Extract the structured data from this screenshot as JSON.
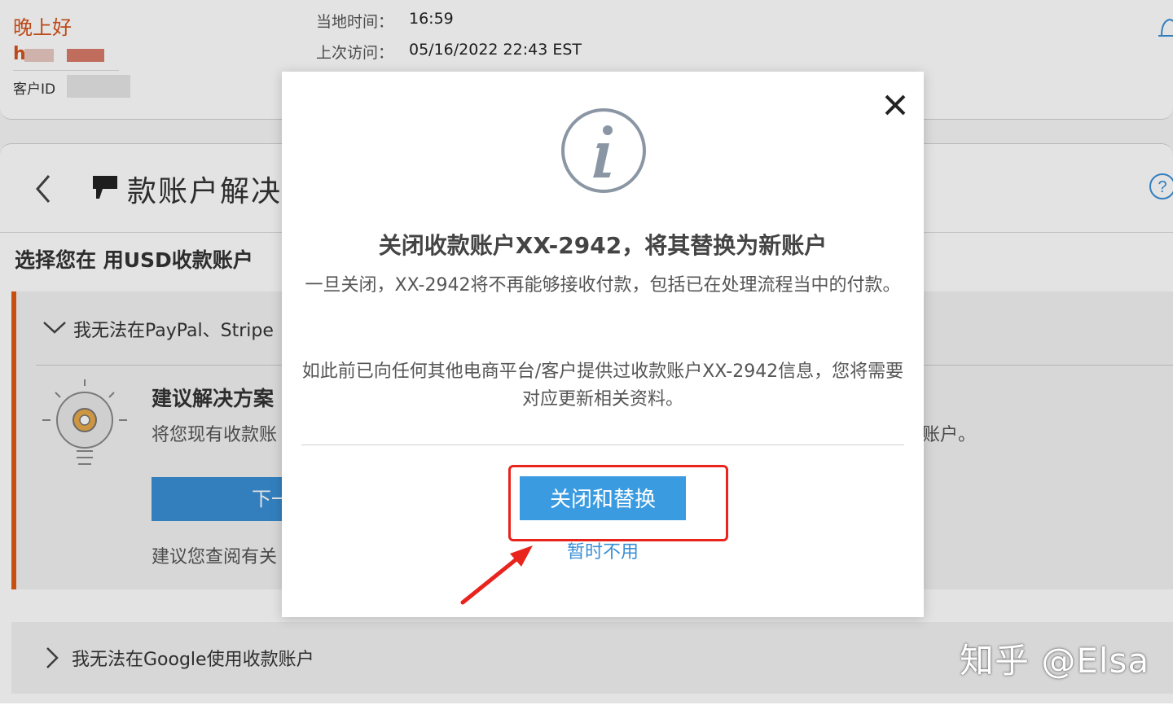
{
  "header": {
    "greeting": "晚上好",
    "user_name_initial": "h",
    "customer_id_label": "客户ID",
    "local_time_label": "当地时间：",
    "local_time_value": "16:59",
    "last_visit_label": "上次访问：",
    "last_visit_value": "05/16/2022 22:43 EST"
  },
  "page": {
    "title": "款账户解决",
    "section_heading": "选择您在    用USD收款账户",
    "issue_1": {
      "title": "我无法在PayPal、Stripe",
      "suggest_title": "建议解决方案",
      "suggest_text": "将您现有收款账",
      "suggest_text_tail": "账户。",
      "next_label": "下一步",
      "review_text": "建议您查阅有关"
    },
    "issue_2": {
      "title": "我无法在Google使用收款账户"
    }
  },
  "modal": {
    "title": "关闭收款账户XX-2942，将其替换为新账户",
    "body_1": "一旦关闭，XX-2942将不再能够接收付款，包括已在处理流程当中的付款。",
    "body_2": "如此前已向任何其他电商平台/客户提供过收款账户XX-2942信息，您将需要对应更新相关资料。",
    "primary_label": "关闭和替换",
    "secondary_label": "暂时不用"
  },
  "watermark": "知乎 @Elsa",
  "colors": {
    "brand_orange": "#d4531c",
    "primary_blue": "#3a9be0",
    "annotation_red": "#e8241d"
  }
}
